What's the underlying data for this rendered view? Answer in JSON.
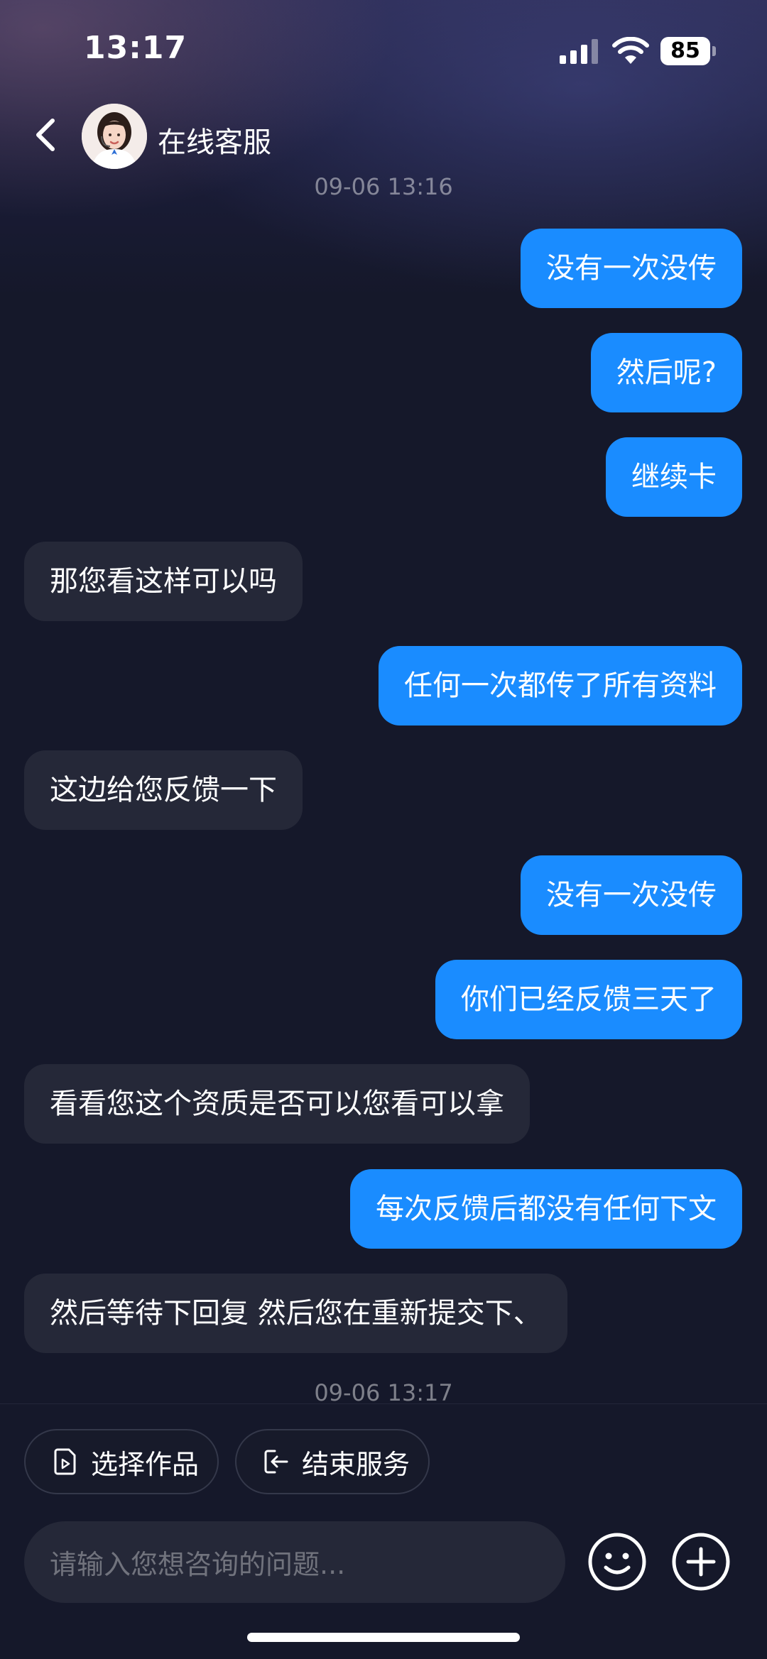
{
  "status_bar": {
    "time": "13:17",
    "battery": "85"
  },
  "header": {
    "title": "在线客服"
  },
  "timestamps": [
    "09-06 13:16",
    "09-06 13:17"
  ],
  "messages": [
    {
      "side": "out",
      "text": "没有一次没传"
    },
    {
      "side": "out",
      "text": "然后呢?"
    },
    {
      "side": "out",
      "text": "继续卡"
    },
    {
      "side": "in",
      "text": "那您看这样可以吗"
    },
    {
      "side": "out",
      "text": "任何一次都传了所有资料"
    },
    {
      "side": "in",
      "text": "这边给您反馈一下"
    },
    {
      "side": "out",
      "text": "没有一次没传"
    },
    {
      "side": "out",
      "text": "你们已经反馈三天了"
    },
    {
      "side": "in",
      "text": "看看您这个资质是否可以您看可以拿"
    },
    {
      "side": "out",
      "text": "每次反馈后都没有任何下文"
    },
    {
      "side": "in",
      "text": "然后等待下回复 然后您在重新提交下、"
    }
  ],
  "quick_actions": {
    "select_work": "选择作品",
    "end_service": "结束服务"
  },
  "composer": {
    "placeholder": "请输入您想咨询的问题..."
  },
  "icons": {
    "back": "chevron-left-icon",
    "select_work": "video-file-icon",
    "end_service": "exit-icon",
    "emoji": "smiley-icon",
    "more": "plus-circle-icon"
  },
  "colors": {
    "outgoing_bubble": "#1a8cff",
    "incoming_bubble": "#252838",
    "background": "#15182a"
  }
}
